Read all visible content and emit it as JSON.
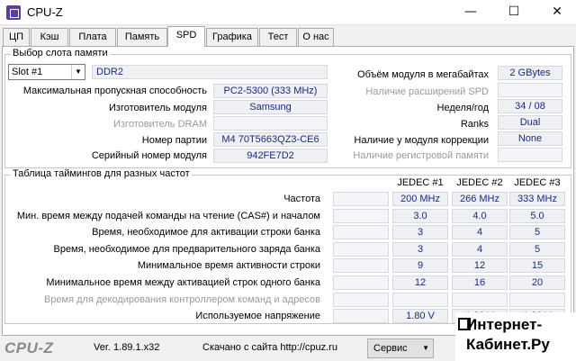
{
  "window": {
    "title": "CPU-Z",
    "minimize": "—",
    "maximize": "☐",
    "close": "✕"
  },
  "tabs": [
    {
      "label": "ЦП"
    },
    {
      "label": "Кэш"
    },
    {
      "label": "Плата"
    },
    {
      "label": "Память"
    },
    {
      "label": "SPD",
      "active": true
    },
    {
      "label": "Графика"
    },
    {
      "label": "Тест"
    },
    {
      "label": "О нас"
    }
  ],
  "slot_group": {
    "title": "Выбор слота памяти",
    "slot_select": "Slot #1",
    "memory_type": "DDR2",
    "max_bandwidth_label": "Максимальная пропускная способность",
    "max_bandwidth": "PC2-5300 (333 MHz)",
    "manufacturer_label": "Изготовитель модуля",
    "manufacturer": "Samsung",
    "dram_manufacturer_label": "Изготовитель DRAM",
    "dram_manufacturer": "",
    "part_number_label": "Номер партии",
    "part_number": "M4 70T5663QZ3-CE6",
    "serial_label": "Серийный номер модуля",
    "serial": "942FE7D2",
    "module_size_label": "Объём модуля в мегабайтах",
    "module_size": "2 GBytes",
    "spd_ext_label": "Наличие расширений SPD",
    "spd_ext": "",
    "week_year_label": "Неделя/год",
    "week_year": "34 / 08",
    "ranks_label": "Ranks",
    "ranks": "Dual",
    "ecc_label": "Наличие у модуля коррекции",
    "ecc": "None",
    "registered_label": "Наличие регистровой памяти",
    "registered": ""
  },
  "timings": {
    "title": "Таблица таймингов для разных частот",
    "columns": [
      "JEDEC #1",
      "JEDEC #2",
      "JEDEC #3"
    ],
    "rows": [
      {
        "label": "Частота",
        "values": [
          "200 MHz",
          "266 MHz",
          "333 MHz"
        ],
        "dim": false
      },
      {
        "label": "Мин. время между подачей команды на чтение (CAS#) и началом",
        "values": [
          "3.0",
          "4.0",
          "5.0"
        ],
        "dim": false
      },
      {
        "label": "Время, необходимое для активации строки банка",
        "values": [
          "3",
          "4",
          "5"
        ],
        "dim": false
      },
      {
        "label": "Время, необходимое для предварительного заряда банка",
        "values": [
          "3",
          "4",
          "5"
        ],
        "dim": false
      },
      {
        "label": "Минимальное время активности строки",
        "values": [
          "9",
          "12",
          "15"
        ],
        "dim": false
      },
      {
        "label": "Минимальное время между активацией строк одного банка",
        "values": [
          "12",
          "16",
          "20"
        ],
        "dim": false
      },
      {
        "label": "Время для декодирования контроллером команд и адресов",
        "values": [
          "",
          "",
          ""
        ],
        "dim": true
      },
      {
        "label": "Используемое напряжение",
        "values": [
          "1.80 V",
          "1.80 V",
          "1.80 V"
        ],
        "dim": false
      }
    ]
  },
  "footer": {
    "brand": "CPU-Z",
    "version": "Ver. 1.89.1.x32",
    "site": "Скачано с сайта http://cpuz.ru",
    "service_button": "Сервис"
  },
  "watermark": {
    "line1": "Интернет-",
    "line2": "Кабинет.Ру"
  },
  "colors": {
    "value_text": "#1a2a80",
    "value_bg": "#eef0f4",
    "brand_gray": "#8a8a8a"
  },
  "icons": [
    "cpuz-app-icon",
    "minimize-icon",
    "maximize-icon",
    "close-icon",
    "dropdown-arrow-icon"
  ]
}
